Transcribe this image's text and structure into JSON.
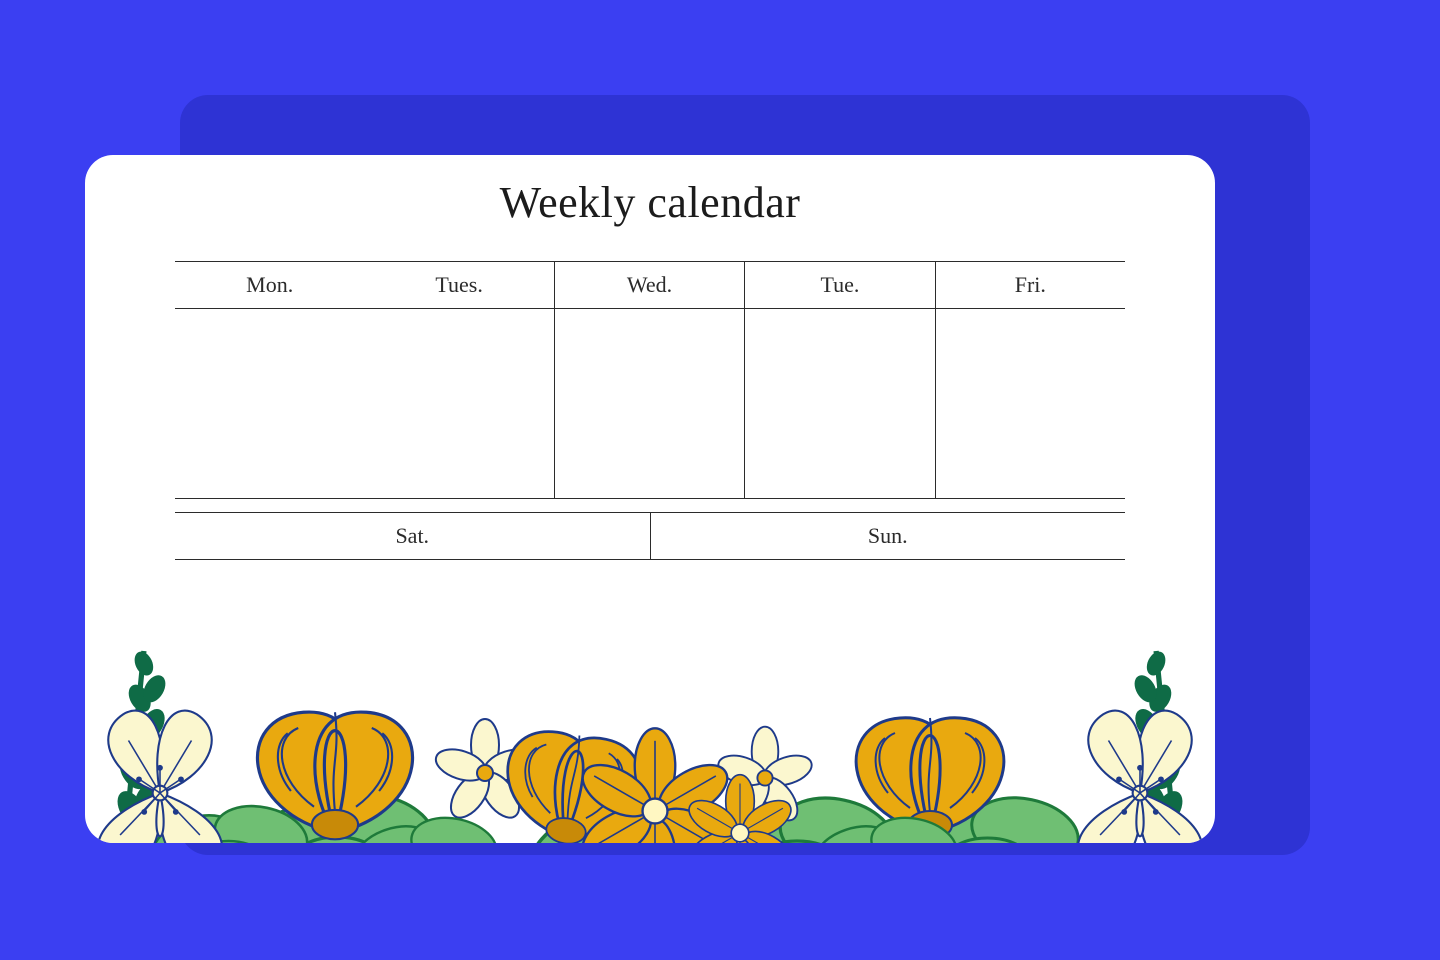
{
  "title": "Weekly calendar",
  "weekdays": [
    "Mon.",
    "Tues.",
    "Wed.",
    "Tue.",
    "Fri."
  ],
  "weekend": {
    "sat": "Sat.",
    "sun": "Sun."
  },
  "colors": {
    "pageBg": "#3b3ff2",
    "backplate": "#2e33d4",
    "card": "#ffffff",
    "line": "#2b2b2b",
    "text": "#1c1c1c",
    "flowerDark": "#eab308",
    "flowerLight": "#fef9c3",
    "leaf": "#15803d",
    "leafLight": "#6fbf73",
    "outline": "#1e3a8a"
  }
}
